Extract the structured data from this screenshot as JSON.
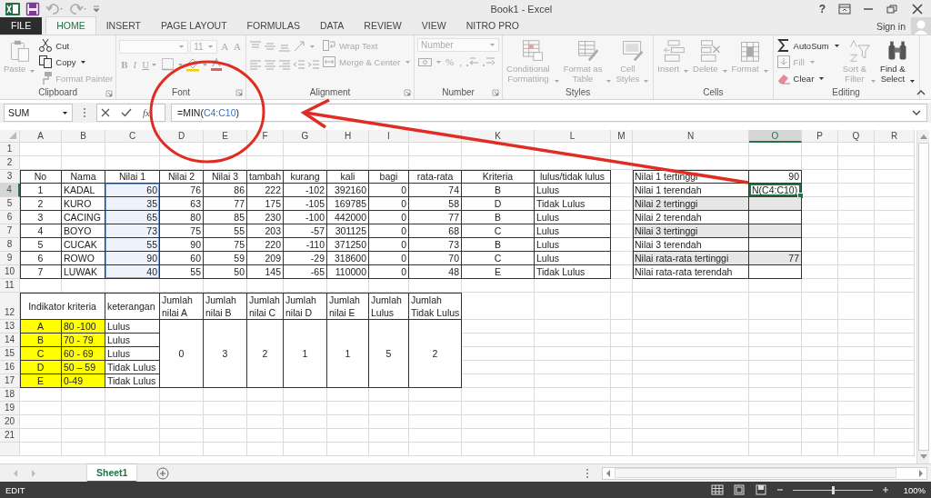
{
  "title_bar": {
    "title": "Book1 - Excel",
    "help": "?"
  },
  "tabs": [
    {
      "label": "FILE",
      "kind": "file",
      "selected": false
    },
    {
      "label": "HOME",
      "kind": "tab",
      "selected": true
    },
    {
      "label": "INSERT",
      "kind": "tab",
      "selected": false
    },
    {
      "label": "PAGE LAYOUT",
      "kind": "tab",
      "selected": false
    },
    {
      "label": "FORMULAS",
      "kind": "tab",
      "selected": false
    },
    {
      "label": "DATA",
      "kind": "tab",
      "selected": false
    },
    {
      "label": "REVIEW",
      "kind": "tab",
      "selected": false
    },
    {
      "label": "VIEW",
      "kind": "tab",
      "selected": false
    },
    {
      "label": "NITRO PRO",
      "kind": "tab",
      "selected": false
    }
  ],
  "account": {
    "label": "Sign in"
  },
  "ribbon": {
    "groups": [
      {
        "label": "Clipboard",
        "launcher": true,
        "columns": [
          [
            [
              {
                "kind": "large",
                "label": "Paste",
                "disabled": true,
                "dropdown": true
              }
            ]
          ],
          [
            [
              {
                "kind": "small",
                "label": "Cut",
                "disabled": false
              }
            ],
            [
              {
                "kind": "small",
                "label": "Copy",
                "disabled": false,
                "dropdown": true
              }
            ],
            [
              {
                "kind": "small",
                "label": "Format Painter",
                "disabled": true
              }
            ]
          ]
        ]
      },
      {
        "label": "Font",
        "launcher": true,
        "columns": [
          [
            [
              {
                "kind": "field",
                "disabled": true,
                "dropdown": true
              },
              {
                "kind": "field",
                "value": "11",
                "disabled": true,
                "dropdown": true
              },
              {
                "kind": "glyph",
                "label": "A",
                "disabled": true
              },
              {
                "kind": "glyph",
                "label": "A",
                "disabled": true
              }
            ],
            [
              {
                "kind": "glyph",
                "label": "B",
                "disabled": true
              },
              {
                "kind": "glyph",
                "label": "I",
                "disabled": true
              },
              {
                "kind": "glyph",
                "label": "U",
                "disabled": true,
                "dropdown": true
              },
              {
                "kind": "icon",
                "disabled": true,
                "dropdown": true
              },
              {
                "kind": "icon",
                "disabled": true,
                "dropdown": true
              },
              {
                "kind": "icon",
                "disabled": true,
                "dropdown": true
              }
            ]
          ]
        ]
      },
      {
        "label": "Alignment",
        "launcher": true,
        "columns": [
          [
            [
              {
                "kind": "icon",
                "disabled": true
              },
              {
                "kind": "icon",
                "disabled": true
              },
              {
                "kind": "icon",
                "disabled": true
              },
              {
                "kind": "icon",
                "disabled": true,
                "dropdown": true
              }
            ],
            [
              {
                "kind": "icon",
                "disabled": true
              },
              {
                "kind": "icon",
                "disabled": true
              },
              {
                "kind": "icon",
                "disabled": true
              },
              {
                "kind": "icon",
                "disabled": true
              },
              {
                "kind": "icon",
                "disabled": true
              }
            ]
          ],
          [
            [
              {
                "kind": "small",
                "label": "Wrap Text",
                "disabled": true
              }
            ],
            [
              {
                "kind": "small",
                "label": "Merge & Center",
                "disabled": true,
                "dropdown": true
              }
            ]
          ]
        ]
      },
      {
        "label": "Number",
        "launcher": true,
        "columns": [
          [
            [
              {
                "kind": "field",
                "value": "Number",
                "disabled": true,
                "dropdown": true
              }
            ],
            [
              {
                "kind": "icon",
                "disabled": true,
                "dropdown": true
              },
              {
                "kind": "glyph",
                "label": "%",
                "disabled": true
              },
              {
                "kind": "glyph",
                "label": ",",
                "disabled": true
              },
              {
                "kind": "icon",
                "disabled": true
              },
              {
                "kind": "icon",
                "disabled": true
              }
            ]
          ]
        ]
      },
      {
        "label": "Styles",
        "launcher": false,
        "columns": [
          [
            [
              {
                "kind": "large",
                "label": "Conditional\nFormatting",
                "disabled": true,
                "dropdown": true
              }
            ]
          ],
          [
            [
              {
                "kind": "large",
                "label": "Format as\nTable",
                "disabled": true,
                "dropdown": true
              }
            ]
          ],
          [
            [
              {
                "kind": "large",
                "label": "Cell\nStyles",
                "disabled": true,
                "dropdown": true
              }
            ]
          ]
        ]
      },
      {
        "label": "Cells",
        "launcher": false,
        "columns": [
          [
            [
              {
                "kind": "large",
                "label": "Insert",
                "disabled": true,
                "dropdown": true
              }
            ]
          ],
          [
            [
              {
                "kind": "large",
                "label": "Delete",
                "disabled": true,
                "dropdown": true
              }
            ]
          ],
          [
            [
              {
                "kind": "large",
                "label": "Format",
                "disabled": true,
                "dropdown": true
              }
            ]
          ]
        ]
      },
      {
        "label": "Editing",
        "launcher": false,
        "columns": [
          [
            [
              {
                "kind": "small",
                "label": "AutoSum",
                "disabled": false,
                "dropdown": true
              }
            ],
            [
              {
                "kind": "small",
                "label": "Fill",
                "disabled": true,
                "dropdown": true
              }
            ],
            [
              {
                "kind": "small",
                "label": "Clear",
                "disabled": false,
                "dropdown": true
              }
            ]
          ],
          [
            [
              {
                "kind": "large",
                "label": "Sort &\nFilter",
                "disabled": true,
                "dropdown": true
              }
            ]
          ],
          [
            [
              {
                "kind": "large",
                "label": "Find &\nSelect",
                "disabled": false,
                "dropdown": true
              }
            ]
          ]
        ]
      }
    ]
  },
  "formula_bar": {
    "name_box": "SUM",
    "function_label": "fx",
    "formula": [
      {
        "text": "=MIN(",
        "kind": "plain"
      },
      {
        "text": "C4:C10",
        "kind": "ref"
      },
      {
        "text": ")",
        "kind": "plain"
      }
    ]
  },
  "sheet": {
    "column_headers": [
      {
        "label": "A",
        "selected": false
      },
      {
        "label": "B",
        "selected": false
      },
      {
        "label": "C",
        "selected": false
      },
      {
        "label": "D",
        "selected": false
      },
      {
        "label": "E",
        "selected": false
      },
      {
        "label": "F",
        "selected": false
      },
      {
        "label": "G",
        "selected": false
      },
      {
        "label": "H",
        "selected": false
      },
      {
        "label": "I",
        "selected": false
      },
      {
        "selected": false
      },
      {
        "label": "K",
        "selected": false
      },
      {
        "label": "L",
        "selected": false
      },
      {
        "label": "M",
        "selected": false
      },
      {
        "label": "N",
        "selected": false
      },
      {
        "label": "O",
        "selected": true
      },
      {
        "label": "P",
        "selected": false
      },
      {
        "label": "Q",
        "selected": false
      },
      {
        "label": "R",
        "selected": false
      }
    ],
    "row_headers": [
      {
        "label": "1",
        "selected": false
      },
      {
        "label": "2",
        "selected": false
      },
      {
        "label": "3",
        "selected": false
      },
      {
        "label": "4",
        "selected": true
      },
      {
        "label": "5",
        "selected": false
      },
      {
        "label": "6",
        "selected": false
      },
      {
        "label": "7",
        "selected": false
      },
      {
        "label": "8",
        "selected": false
      },
      {
        "label": "9",
        "selected": false
      },
      {
        "label": "10",
        "selected": false
      },
      {
        "label": "11",
        "selected": false
      },
      {
        "label": "12",
        "selected": false
      },
      {
        "label": "13",
        "selected": false
      },
      {
        "label": "14",
        "selected": false
      },
      {
        "label": "15",
        "selected": false
      },
      {
        "label": "16",
        "selected": false
      },
      {
        "label": "17",
        "selected": false
      },
      {
        "label": "18",
        "selected": false
      },
      {
        "label": "19",
        "selected": false
      },
      {
        "label": "20",
        "selected": false
      },
      {
        "label": "21",
        "selected": false
      }
    ],
    "main_table": {
      "columns": [
        {
          "label": "No",
          "kind": "center",
          "highlighted": false
        },
        {
          "label": "Nama",
          "kind": "text",
          "highlighted": false
        },
        {
          "label": "Nilai 1",
          "kind": "number",
          "highlighted": true
        },
        {
          "label": "Nilai 2",
          "kind": "number",
          "highlighted": false
        },
        {
          "label": "Nilai 3",
          "kind": "number",
          "highlighted": false
        },
        {
          "label": "tambah",
          "kind": "number",
          "highlighted": false
        },
        {
          "label": "kurang",
          "kind": "number",
          "highlighted": false
        },
        {
          "label": "kali",
          "kind": "number",
          "highlighted": false
        },
        {
          "label": "bagi",
          "kind": "number",
          "highlighted": false
        },
        {
          "label": "rata-rata",
          "kind": "number",
          "highlighted": false
        },
        {
          "label": "Kriteria",
          "kind": "center",
          "highlighted": false
        },
        {
          "label": "lulus/tidak lulus",
          "kind": "text",
          "highlighted": false
        }
      ],
      "rows": [
        [
          "1",
          "KADAL",
          "60",
          "76",
          "86",
          "222",
          "-102",
          "392160",
          "0",
          "74",
          "B",
          "Lulus"
        ],
        [
          "2",
          "KURO",
          "35",
          "63",
          "77",
          "175",
          "-105",
          "169785",
          "0",
          "58",
          "D",
          "Tidak Lulus"
        ],
        [
          "3",
          "CACING",
          "65",
          "80",
          "85",
          "230",
          "-100",
          "442000",
          "0",
          "77",
          "B",
          "Lulus"
        ],
        [
          "4",
          "BOYO",
          "73",
          "75",
          "55",
          "203",
          "-57",
          "301125",
          "0",
          "68",
          "C",
          "Lulus"
        ],
        [
          "5",
          "CUCAK",
          "55",
          "90",
          "75",
          "220",
          "-110",
          "371250",
          "0",
          "73",
          "B",
          "Lulus"
        ],
        [
          "6",
          "ROWO",
          "90",
          "60",
          "59",
          "209",
          "-29",
          "318600",
          "0",
          "70",
          "C",
          "Lulus"
        ],
        [
          "7",
          "LUWAK",
          "40",
          "55",
          "50",
          "145",
          "-65",
          "110000",
          "0",
          "48",
          "E",
          "Tidak Lulus"
        ]
      ]
    },
    "summary_table": {
      "rows": [
        {
          "label": "Nilai 1 tertinggi",
          "value": "90",
          "shaded": false,
          "active": false
        },
        {
          "label": "Nilai 1 terendah",
          "value": "N(C4:C10)",
          "shaded": false,
          "active": true
        },
        {
          "label": "Nilai 2 tertinggi",
          "shaded": true,
          "active": false
        },
        {
          "label": "Nilai 2 terendah",
          "shaded": false,
          "active": false
        },
        {
          "label": "Nilai 3 tertinggi",
          "shaded": true,
          "active": false
        },
        {
          "label": "Nilai 3 terendah",
          "shaded": false,
          "active": false
        },
        {
          "label": "Nilai rata-rata tertinggi",
          "value": "77",
          "shaded": true,
          "active": false
        },
        {
          "label": "Nilai rata-rata terendah",
          "shaded": false,
          "active": false
        }
      ]
    },
    "criteria_table": {
      "title": "Indikator kriteria",
      "note_header": "keterangan",
      "rows": [
        {
          "grade": "A",
          "range": "80 -100",
          "note": "Lulus"
        },
        {
          "grade": "B",
          "range": "70 - 79",
          "note": "Lulus"
        },
        {
          "grade": "C",
          "range": "60 - 69",
          "note": "Lulus"
        },
        {
          "grade": "D",
          "range": "50 – 59",
          "note": "Tidak Lulus"
        },
        {
          "grade": "E",
          "range": "0-49",
          "note": "Tidak Lulus"
        }
      ]
    },
    "count_table": {
      "columns": [
        {
          "label": "Jumlah\nnilai A",
          "value": "0"
        },
        {
          "label": "Jumlah\nnilai B",
          "value": "3"
        },
        {
          "label": "Jumlah\nnilai C",
          "value": "2"
        },
        {
          "label": "Jumlah\nnilai D",
          "value": "1"
        },
        {
          "label": "Jumlah\nnilai E",
          "value": "1"
        },
        {
          "label": "Jumlah\nLulus",
          "value": "5"
        },
        {
          "label": "Jumlah\nTidak Lulus",
          "value": "2"
        }
      ]
    }
  },
  "sheet_tabs": [
    {
      "label": "Sheet1",
      "selected": true
    }
  ],
  "status_bar": {
    "mode": "EDIT",
    "zoom": {
      "level": 0.5,
      "reading": "100%"
    }
  }
}
